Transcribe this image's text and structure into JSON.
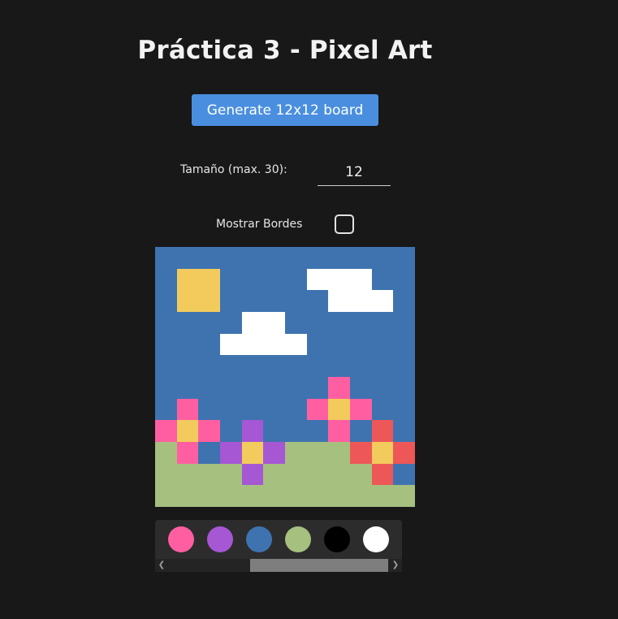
{
  "header": {
    "title": "Práctica 3 - Pixel Art"
  },
  "controls": {
    "generate_button_label": "Generate 12x12 board",
    "size_label": "Tamaño (max. 30):",
    "size_value": "12",
    "borders_label": "Mostrar Bordes",
    "borders_checked": false
  },
  "board": {
    "rows": 12,
    "cols": 12,
    "colors": {
      "S": "#3f73b0",
      "Y": "#f2cb5c",
      "W": "#ffffff",
      "P": "#ff5fa0",
      "U": "#a657d4",
      "G": "#a5c07f",
      "R": "#ee5757"
    },
    "grid": [
      "SSSSSSSSSSSS",
      "SYYSSSSWWWSS",
      "SYYSSSSSWWWS",
      "SSSSWWSSSSSS",
      "SSSWWWWSSSSS",
      "SSSSSSSSSSSS",
      "SSSSSSSSPSSS",
      "SPSSSSSPYPSS",
      "PYPSUSSSPSRS",
      "GPSUYUGGGRYR",
      "GGGGUGGGGGRS",
      "GGGGGGGGGGGG"
    ]
  },
  "palette": {
    "swatches": [
      {
        "name": "pink",
        "color": "#ff5fa0"
      },
      {
        "name": "purple",
        "color": "#a657d4"
      },
      {
        "name": "blue",
        "color": "#3f73b0"
      },
      {
        "name": "green",
        "color": "#a5c07f"
      },
      {
        "name": "black",
        "color": "#000000"
      },
      {
        "name": "white",
        "color": "#ffffff"
      }
    ],
    "scroll_left_icon": "chevron-left-icon",
    "scroll_right_icon": "chevron-right-icon"
  }
}
